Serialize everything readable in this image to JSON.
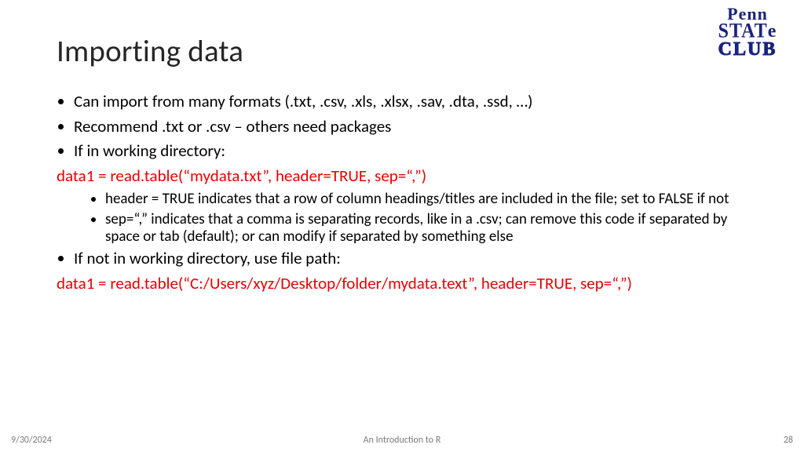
{
  "logo": {
    "l1": "Penn",
    "l2_stat": "STAT",
    "l2_e": "e",
    "l3": "CLUB"
  },
  "title": "Importing data",
  "bullets": {
    "b1": "Can import from many formats (.txt, .csv, .xls, .xlsx, .sav, .dta, .ssd, …)",
    "b2": "Recommend .txt or .csv – others need packages",
    "b3": "If in working directory:",
    "code1": "data1 = read.table(“mydata.txt”, header=TRUE, sep=“,”)",
    "sub1": "header = TRUE indicates that a row of column headings/titles are included in the file; set to FALSE if not",
    "sub2": "sep=“,” indicates that a comma is separating records, like in a .csv; can remove this code if separated by space or tab (default); or can modify if separated by something else",
    "b4": "If not in working directory, use file path:",
    "code2": "data1 = read.table(“C:/Users/xyz/Desktop/folder/mydata.text”, header=TRUE, sep=“,”)"
  },
  "footer": {
    "date": "9/30/2024",
    "title": "An Introduction to R",
    "page": "28"
  }
}
